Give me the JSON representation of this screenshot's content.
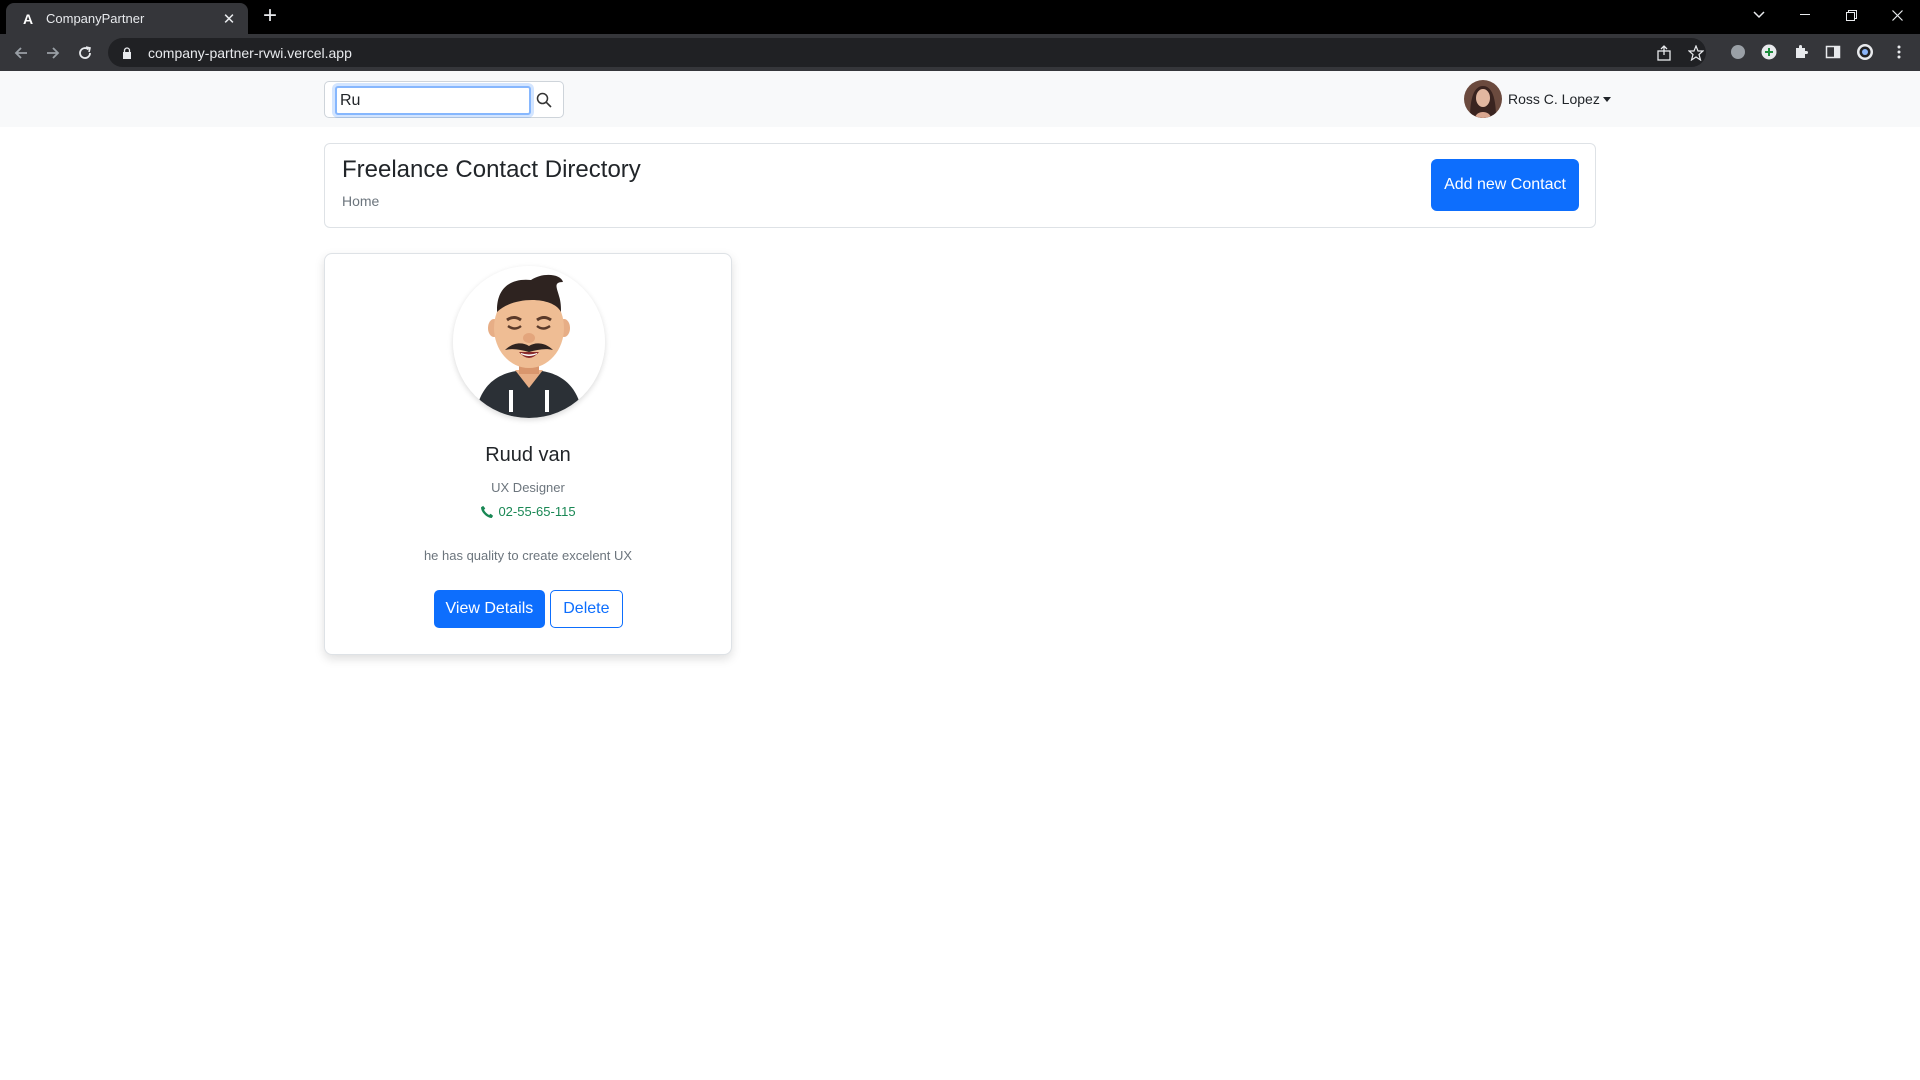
{
  "browser": {
    "tab_title": "CompanyPartner",
    "tab_favicon": "A",
    "url": "company-partner-rvwi.vercel.app"
  },
  "navbar": {
    "search_value": "Ru",
    "user_name": "Ross C. Lopez"
  },
  "header": {
    "title": "Freelance Contact Directory",
    "breadcrumb": "Home",
    "add_button": "Add new Contact"
  },
  "contacts": [
    {
      "name": "Ruud van",
      "role": "UX Designer",
      "phone": "02-55-65-115",
      "description": "he has quality to create excelent UX",
      "view_button": "View Details",
      "delete_button": "Delete"
    }
  ],
  "colors": {
    "primary": "#0d6efd",
    "success": "#198754",
    "muted": "#6c757d"
  },
  "icons": {
    "search": "search-icon",
    "phone": "phone-icon",
    "caret": "caret-down-icon"
  }
}
